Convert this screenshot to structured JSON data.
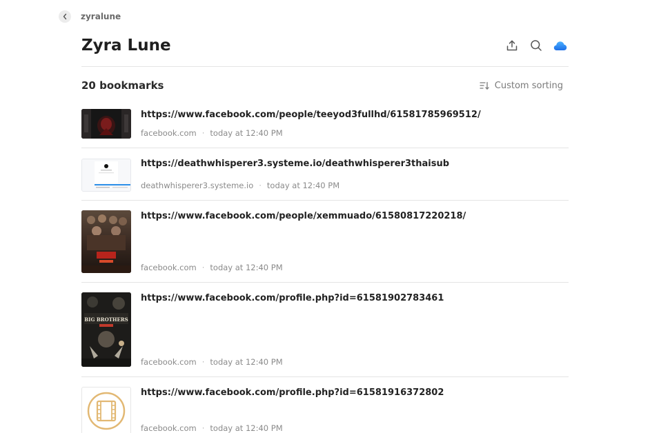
{
  "breadcrumb": {
    "label": "zyralune"
  },
  "header": {
    "title": "Zyra Lune"
  },
  "toolbar": {
    "count_label": "20 bookmarks",
    "sort_label": "Custom sorting"
  },
  "colors": {
    "accent_cloud": "#2f7ff0",
    "divider": "#e4e4e4",
    "meta_text": "#8a8a8a"
  },
  "bookmarks": [
    {
      "url": "https://www.facebook.com/people/teeyod3fullhd/61581785969512/",
      "domain": "facebook.com",
      "time": "today at 12:40 PM",
      "thumb": "dark-movie-poster"
    },
    {
      "url": "https://deathwhisperer3.systeme.io/deathwhisperer3thaisub",
      "domain": "deathwhisperer3.systeme.io",
      "time": "today at 12:40 PM",
      "thumb": "webpage-screenshot"
    },
    {
      "url": "https://www.facebook.com/people/xemmuado/61580817220218/",
      "domain": "facebook.com",
      "time": "today at 12:40 PM",
      "thumb": "action-movie-poster"
    },
    {
      "url": "https://www.facebook.com/profile.php?id=61581902783461",
      "domain": "facebook.com",
      "time": "today at 12:40 PM",
      "thumb": "big-brothers-poster"
    },
    {
      "url": "https://www.facebook.com/profile.php?id=61581916372802",
      "domain": "facebook.com",
      "time": "today at 12:40 PM",
      "thumb": "film-placeholder-icon"
    }
  ]
}
